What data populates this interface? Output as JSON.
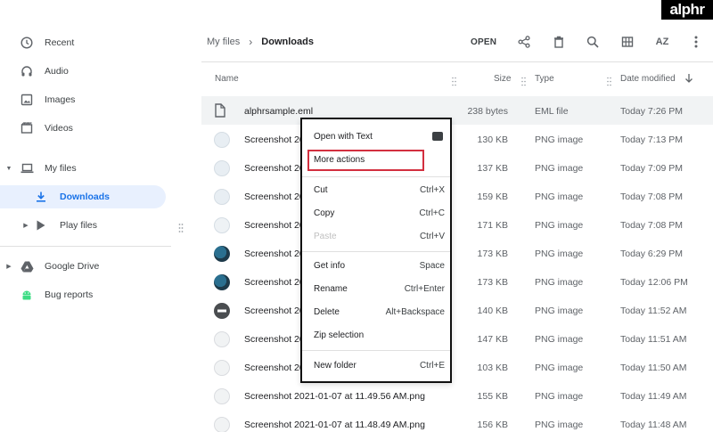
{
  "logo": {
    "text": "alphr"
  },
  "sidebar": {
    "items": [
      {
        "label": "Recent",
        "icon": "clock-icon"
      },
      {
        "label": "Audio",
        "icon": "headphones-icon"
      },
      {
        "label": "Images",
        "icon": "image-icon"
      },
      {
        "label": "Videos",
        "icon": "film-icon"
      },
      {
        "label": "My files",
        "icon": "laptop-icon"
      },
      {
        "label": "Downloads",
        "icon": "download-icon"
      },
      {
        "label": "Play files",
        "icon": "play-store-icon"
      },
      {
        "label": "Google Drive",
        "icon": "drive-icon"
      },
      {
        "label": "Bug reports",
        "icon": "android-icon"
      }
    ]
  },
  "breadcrumb": {
    "root": "My files",
    "separator": "›",
    "current": "Downloads"
  },
  "toolbar": {
    "open_label": "OPEN",
    "sort_icon_text": "AZ"
  },
  "columns": {
    "name": "Name",
    "size": "Size",
    "type": "Type",
    "date": "Date modified"
  },
  "files": [
    {
      "name": "alphrsample.eml",
      "size": "238 bytes",
      "type": "EML file",
      "date": "Today 7:26 PM"
    },
    {
      "name": "Screenshot 20",
      "size": "130 KB",
      "type": "PNG image",
      "date": "Today 7:13 PM"
    },
    {
      "name": "Screenshot 20",
      "size": "137 KB",
      "type": "PNG image",
      "date": "Today 7:09 PM"
    },
    {
      "name": "Screenshot 20",
      "size": "159 KB",
      "type": "PNG image",
      "date": "Today 7:08 PM"
    },
    {
      "name": "Screenshot 20",
      "size": "171 KB",
      "type": "PNG image",
      "date": "Today 7:08 PM"
    },
    {
      "name": "Screenshot 20",
      "size": "173 KB",
      "type": "PNG image",
      "date": "Today 6:29 PM"
    },
    {
      "name": "Screenshot 20",
      "size": "173 KB",
      "type": "PNG image",
      "date": "Today 12:06 PM"
    },
    {
      "name": "Screenshot 20",
      "size": "140 KB",
      "type": "PNG image",
      "date": "Today 11:52 AM"
    },
    {
      "name": "Screenshot 20",
      "size": "147 KB",
      "type": "PNG image",
      "date": "Today 11:51 AM"
    },
    {
      "name": "Screenshot 20",
      "size": "103 KB",
      "type": "PNG image",
      "date": "Today 11:50 AM"
    },
    {
      "name": "Screenshot 2021-01-07 at 11.49.56 AM.png",
      "size": "155 KB",
      "type": "PNG image",
      "date": "Today 11:49 AM"
    },
    {
      "name": "Screenshot 2021-01-07 at 11.48.49 AM.png",
      "size": "156 KB",
      "type": "PNG image",
      "date": "Today 11:48 AM"
    }
  ],
  "context_menu": {
    "items": [
      {
        "label": "Open with Text",
        "shortcut": ""
      },
      {
        "label": "More actions",
        "shortcut": ""
      },
      {
        "label": "Cut",
        "shortcut": "Ctrl+X"
      },
      {
        "label": "Copy",
        "shortcut": "Ctrl+C"
      },
      {
        "label": "Paste",
        "shortcut": "Ctrl+V"
      },
      {
        "label": "Get info",
        "shortcut": "Space"
      },
      {
        "label": "Rename",
        "shortcut": "Ctrl+Enter"
      },
      {
        "label": "Delete",
        "shortcut": "Alt+Backspace"
      },
      {
        "label": "Zip selection",
        "shortcut": ""
      },
      {
        "label": "New folder",
        "shortcut": "Ctrl+E"
      }
    ]
  },
  "colors": {
    "accent": "#1a73e8",
    "active_bg": "#e8f0fe",
    "highlight_border": "#d32f3f",
    "selected_row": "#f1f3f4"
  }
}
